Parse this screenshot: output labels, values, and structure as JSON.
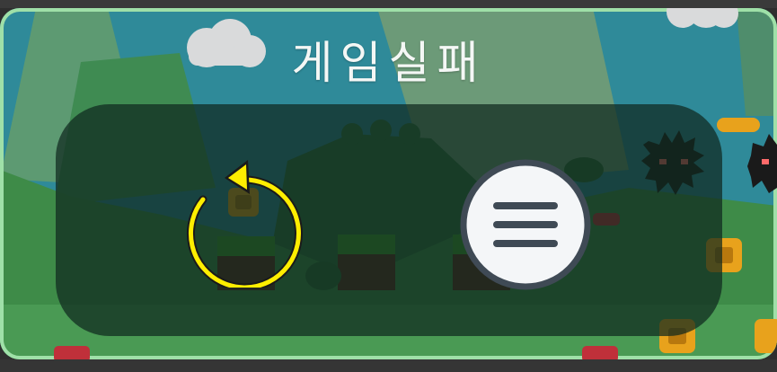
{
  "header": {
    "title": "게임실패"
  },
  "buttons": {
    "retry_icon": "retry-icon",
    "menu_icon": "hamburger-menu-icon"
  },
  "colors": {
    "overlay": "#0f281e",
    "retry_yellow": "#ffee00",
    "menu_fill": "#f4f6f8",
    "menu_ring": "#3f4a55"
  }
}
